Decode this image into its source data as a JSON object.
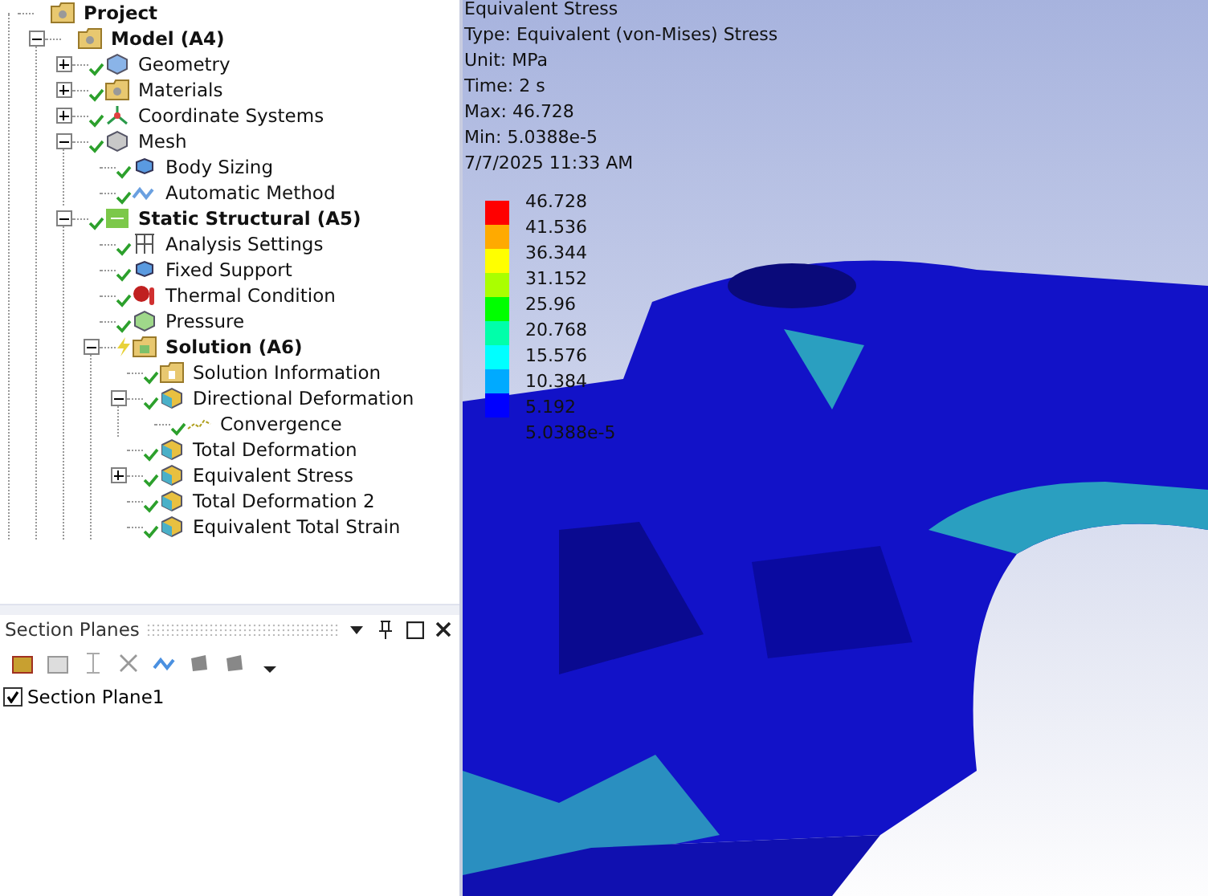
{
  "tree": [
    {
      "label": "Project",
      "kind": "project",
      "bold": true,
      "children": [
        {
          "label": "Model (A4)",
          "kind": "model",
          "bold": true,
          "expanded": true,
          "children": [
            {
              "label": "Geometry",
              "kind": "geometry",
              "solved": true,
              "bold": false,
              "expanded": false
            },
            {
              "label": "Materials",
              "kind": "materials",
              "solved": true,
              "bold": false,
              "expanded": false
            },
            {
              "label": "Coordinate Systems",
              "kind": "coordinates",
              "solved": true,
              "bold": false,
              "expanded": false
            },
            {
              "label": "Mesh",
              "kind": "mesh",
              "solved": true,
              "bold": false,
              "expanded": true,
              "children": [
                {
                  "label": "Body Sizing",
                  "kind": "sizing",
                  "solved": true,
                  "bold": false
                },
                {
                  "label": "Automatic Method",
                  "kind": "method",
                  "solved": true,
                  "bold": false
                }
              ]
            },
            {
              "label": "Static Structural (A5)",
              "kind": "static",
              "solved": true,
              "bold": true,
              "expanded": true,
              "children": [
                {
                  "label": "Analysis Settings",
                  "kind": "settings",
                  "solved": true,
                  "bold": false
                },
                {
                  "label": "Fixed Support",
                  "kind": "support",
                  "solved": true,
                  "bold": false
                },
                {
                  "label": "Thermal Condition",
                  "kind": "thermal",
                  "solved": true,
                  "bold": false
                },
                {
                  "label": "Pressure",
                  "kind": "pressure",
                  "solved": true,
                  "bold": false
                },
                {
                  "label": "Solution (A6)",
                  "kind": "solution",
                  "solved": false,
                  "bold": true,
                  "expanded": true,
                  "children": [
                    {
                      "label": "Solution Information",
                      "kind": "info",
                      "solved": true,
                      "bold": false
                    },
                    {
                      "label": "Directional Deformation",
                      "kind": "result",
                      "solved": true,
                      "bold": false,
                      "expanded": true,
                      "children": [
                        {
                          "label": "Convergence",
                          "kind": "convergence",
                          "solved": true,
                          "bold": false
                        }
                      ]
                    },
                    {
                      "label": "Total Deformation",
                      "kind": "result",
                      "solved": true,
                      "bold": false
                    },
                    {
                      "label": "Equivalent Stress",
                      "kind": "result",
                      "solved": true,
                      "bold": false,
                      "expanded": false
                    },
                    {
                      "label": "Total Deformation 2",
                      "kind": "result",
                      "solved": true,
                      "bold": false
                    },
                    {
                      "label": "Equivalent Total Strain",
                      "kind": "result",
                      "solved": true,
                      "bold": false
                    }
                  ]
                }
              ]
            }
          ]
        }
      ]
    }
  ],
  "section_planes": {
    "title": "Section Planes",
    "items": [
      {
        "label": "Section Plane1",
        "checked": true
      }
    ]
  },
  "viewport": {
    "info": [
      "Equivalent Stress",
      "Type: Equivalent (von-Mises) Stress",
      "Unit: MPa",
      "Time: 2 s",
      "Max: 46.728",
      "Min: 5.0388e-5",
      "7/7/2025 11:33 AM"
    ],
    "legend": {
      "labels": [
        "46.728",
        "41.536",
        "36.344",
        "31.152",
        "25.96",
        "20.768",
        "15.576",
        "10.384",
        "5.192",
        "5.0388e-5"
      ],
      "bands": [
        {
          "color": "#ff0000"
        },
        {
          "color": "#ffaa00"
        },
        {
          "color": "#ffff00"
        },
        {
          "color": "#aaff00"
        },
        {
          "color": "#00ff00"
        },
        {
          "color": "#00ffaa"
        },
        {
          "color": "#00ffff"
        },
        {
          "color": "#00aaff"
        },
        {
          "color": "#0000ff"
        }
      ]
    }
  }
}
